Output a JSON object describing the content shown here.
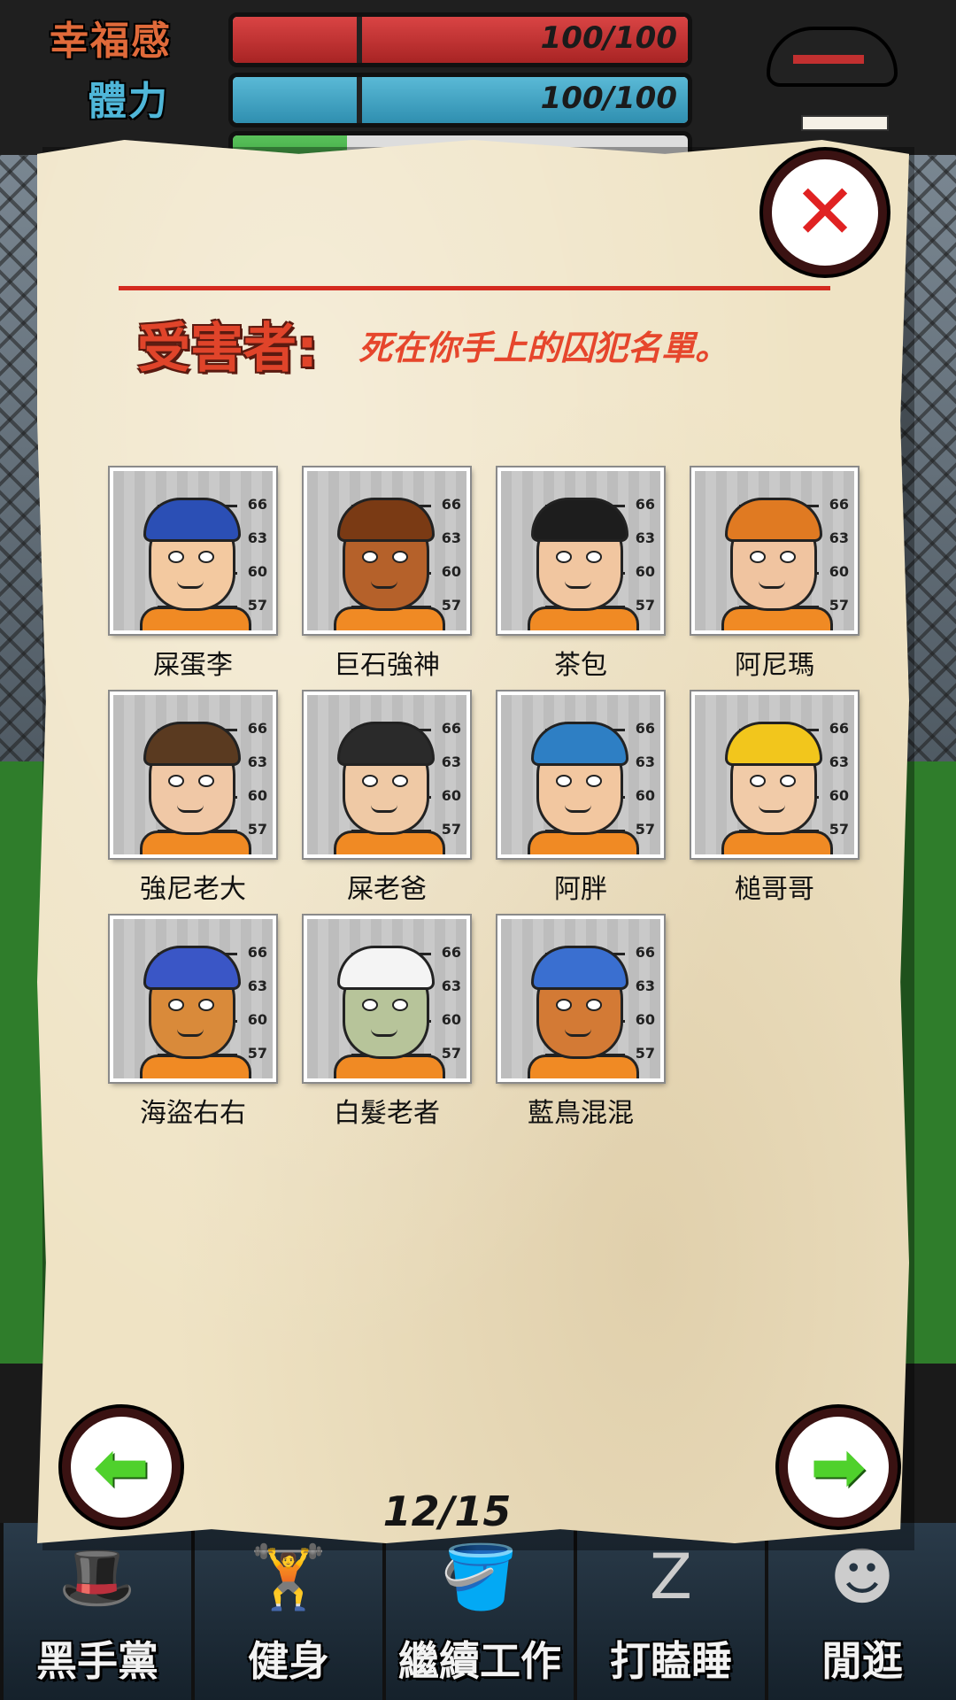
{
  "hud": {
    "stats": [
      {
        "label": "幸福感",
        "value_text": "100/100",
        "fill": 1.0
      },
      {
        "label": "體力",
        "value_text": "100/100",
        "fill": 1.0
      }
    ]
  },
  "dialog": {
    "title": "受害者:",
    "subtitle": "死在你手上的囚犯名單。",
    "close_symbol": "✕",
    "page_indicator": "12/15",
    "prev_symbol": "⬅",
    "next_symbol": "➡"
  },
  "height_scale": [
    "66",
    "63",
    "60",
    "57"
  ],
  "victims": [
    {
      "name": "屎蛋李",
      "skin": "#f3c9a0",
      "hair": "#2a2a2a",
      "hat": "#2b4fb5"
    },
    {
      "name": "巨石強神",
      "skin": "#b5612a",
      "hair": "#7a3a14",
      "hat": ""
    },
    {
      "name": "茶包",
      "skin": "#f1c6a0",
      "hair": "#1d1d1d",
      "hat": ""
    },
    {
      "name": "阿尼瑪",
      "skin": "#f0c4a0",
      "hair": "#e07a22",
      "hat": ""
    },
    {
      "name": "強尼老大",
      "skin": "#f0c8a6",
      "hair": "#5a3a20",
      "hat": ""
    },
    {
      "name": "屎老爸",
      "skin": "#efc9a5",
      "hair": "#2a2a2a",
      "hat": ""
    },
    {
      "name": "阿胖",
      "skin": "#f2c7a0",
      "hair": "#7a4a20",
      "hat": "#2e7fc4"
    },
    {
      "name": "槌哥哥",
      "skin": "#f1cba8",
      "hair": "#f2c61c",
      "hat": ""
    },
    {
      "name": "海盜右右",
      "skin": "#d98a3a",
      "hair": "#2b2b2b",
      "hat": "#3a56c6"
    },
    {
      "name": "白髮老者",
      "skin": "#b7c49a",
      "hair": "#f4f4f4",
      "hat": ""
    },
    {
      "name": "藍鳥混混",
      "skin": "#d37a35",
      "hair": "#3a6fd0",
      "hat": ""
    }
  ],
  "menu": {
    "items": [
      {
        "label": "黑手黨",
        "icon": "hat-icon"
      },
      {
        "label": "健身",
        "icon": "dumbbell-icon"
      },
      {
        "label": "繼續工作",
        "icon": "mop-bucket-icon"
      },
      {
        "label": "打瞌睡",
        "icon": "sleep-icon"
      },
      {
        "label": "閒逛",
        "icon": "prisoner-icon"
      }
    ]
  }
}
